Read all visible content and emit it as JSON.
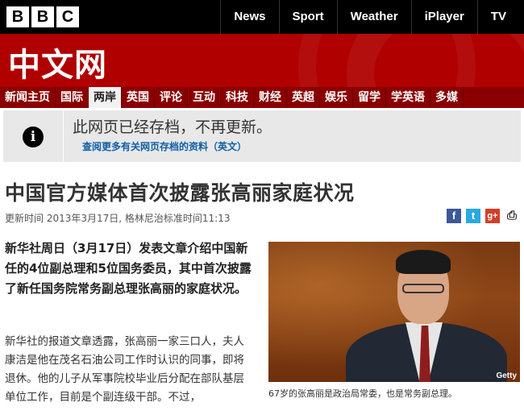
{
  "brand": {
    "letters": [
      "B",
      "B",
      "C"
    ]
  },
  "topnav": {
    "items": [
      "News",
      "Sport",
      "Weather",
      "iPlayer",
      "TV"
    ]
  },
  "masthead": {
    "title": "中文网"
  },
  "secnav": {
    "items": [
      "新闻主页",
      "国际",
      "两岸",
      "英国",
      "评论",
      "互动",
      "科技",
      "财经",
      "英超",
      "娱乐",
      "留学",
      "学英语",
      "多媒"
    ],
    "active_index": 2
  },
  "notice": {
    "icon": "info-icon",
    "message": "此网页已经存档，不再更新。",
    "link": "查阅更多有关网页存档的资料（英文）"
  },
  "article": {
    "headline": "中国官方媒体首次披露张高丽家庭状况",
    "dateline": "更新时间 2013年3月17日, 格林尼治标准时间11:13",
    "lead": "新华社周日（3月17日）发表文章介绍中国新任的4位副总理和5位国务委员，其中首次披露了新任国务院常务副总理张高丽的家庭状况。",
    "body": "新华社的报道文章透露，张高丽一家三口人，夫人康洁是他在茂名石油公司工作时认识的同事，即将退休。他的儿子从军事院校毕业后分配在部队基层单位工作，目前是个副连级干部。不过，",
    "photo_credit": "Getty",
    "caption": "67岁的张高丽是政治局常委，也是常务副总理。"
  },
  "share": {
    "facebook": "f",
    "twitter": "t",
    "google": "g+",
    "print": "⎙"
  },
  "colors": {
    "masthead_red": "#b00000",
    "nav_red": "#8a0000",
    "link_blue": "#0f5ea8"
  }
}
